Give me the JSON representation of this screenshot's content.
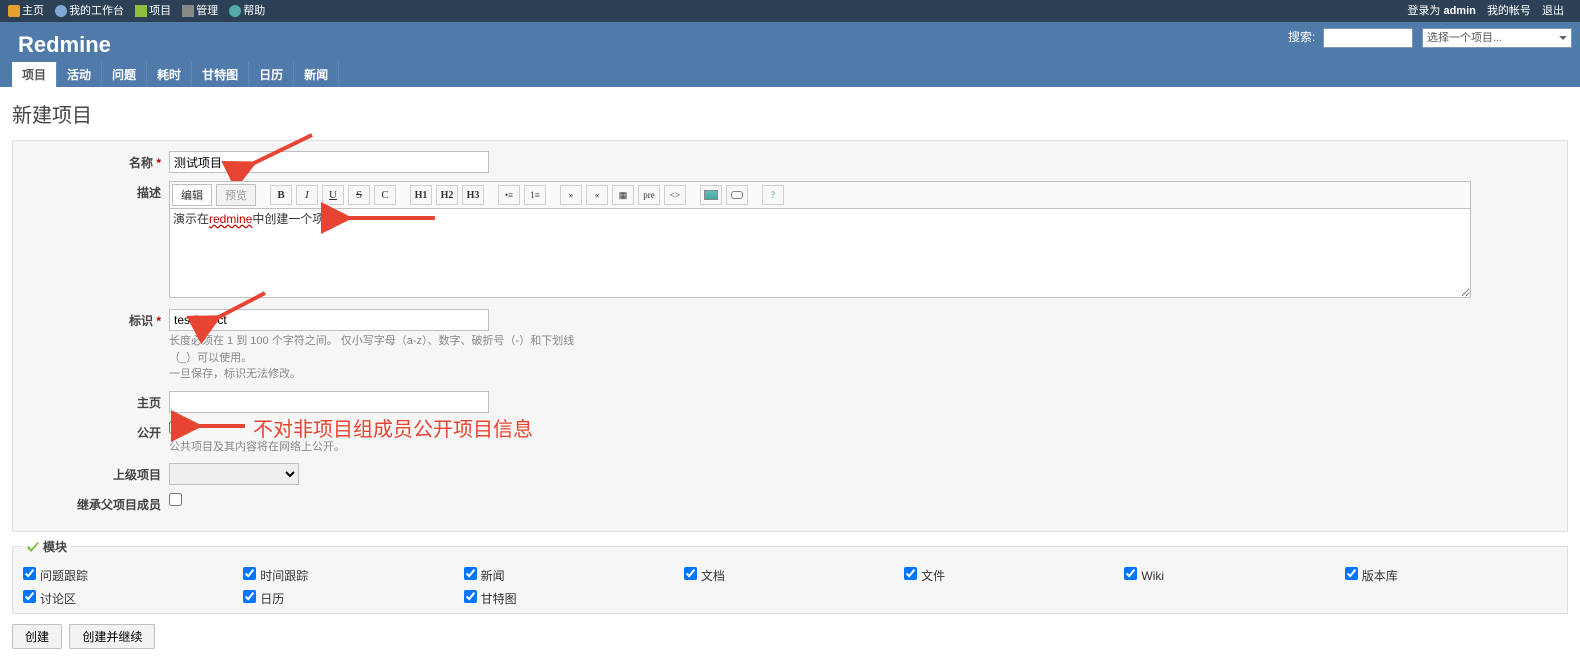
{
  "topMenu": {
    "home": "主页",
    "myPage": "我的工作台",
    "projects": "项目",
    "admin": "管理",
    "help": "帮助",
    "loggedAs": "登录为",
    "loginUser": "admin",
    "myAccount": "我的帐号",
    "logout": "退出"
  },
  "header": {
    "title": "Redmine",
    "searchLabel": "搜索:",
    "searchValue": "",
    "projectJump": "选择一个项目..."
  },
  "mainMenu": {
    "items": [
      "项目",
      "活动",
      "问题",
      "耗时",
      "甘特图",
      "日历",
      "新闻"
    ]
  },
  "page": {
    "title": "新建项目"
  },
  "form": {
    "nameLabel": "名称",
    "nameValue": "测试项目",
    "descLabel": "描述",
    "descTabEdit": "编辑",
    "descTabPreview": "预览",
    "descPrefix": "演示在",
    "descRed": "redmine",
    "descSuffix": "中创建一个项目",
    "identLabel": "标识",
    "identValue": "testPoject",
    "identHelp": "长度必须在 1 到 100 个字符之间。 仅小写字母（a-z）、数字、破折号（-）和下划线（_）可以使用。\n一旦保存，标识无法修改。",
    "homepageLabel": "主页",
    "homepageValue": "",
    "publicLabel": "公开",
    "publicHelp": "公共项目及其内容将在网络上公开。",
    "parentLabel": "上级项目",
    "inheritLabel": "继承父项目成员"
  },
  "modules": {
    "legend": "模块",
    "items": [
      {
        "label": "问题跟踪",
        "checked": true
      },
      {
        "label": "时间跟踪",
        "checked": true
      },
      {
        "label": "新闻",
        "checked": true
      },
      {
        "label": "文档",
        "checked": true
      },
      {
        "label": "文件",
        "checked": true
      },
      {
        "label": "Wiki",
        "checked": true
      },
      {
        "label": "版本库",
        "checked": true
      },
      {
        "label": "讨论区",
        "checked": true
      },
      {
        "label": "日历",
        "checked": true
      },
      {
        "label": "甘特图",
        "checked": true
      }
    ]
  },
  "buttons": {
    "create": "创建",
    "createContinue": "创建并继续"
  },
  "annotations": {
    "publicNote": "不对非项目组成员公开项目信息"
  }
}
